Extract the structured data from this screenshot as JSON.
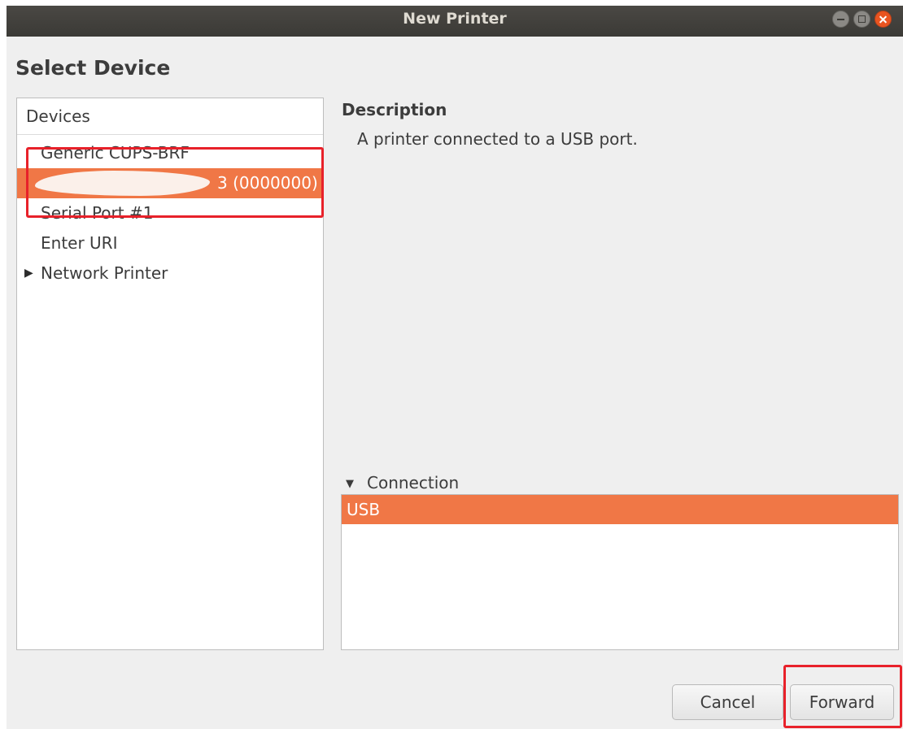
{
  "window": {
    "title": "New Printer"
  },
  "page": {
    "title": "Select Device"
  },
  "devices": {
    "header": "Devices",
    "items": [
      {
        "label": "Generic CUPS-BRF"
      },
      {
        "label": "3 (0000000)",
        "selected": true,
        "partially_redacted": true
      },
      {
        "label": "Serial Port #1"
      },
      {
        "label": "Enter URI"
      },
      {
        "label": "Network Printer",
        "expander": "▶"
      }
    ]
  },
  "description": {
    "heading": "Description",
    "text": "A printer connected to a USB port."
  },
  "connection": {
    "header": "Connection",
    "expander": "▼",
    "items": [
      {
        "label": "USB",
        "selected": true
      }
    ]
  },
  "buttons": {
    "cancel": "Cancel",
    "forward": "Forward"
  },
  "colors": {
    "selection": "#f07746",
    "titlebar": "#3c3b37",
    "close_button": "#e95420",
    "annotation_box": "#e8212a"
  }
}
